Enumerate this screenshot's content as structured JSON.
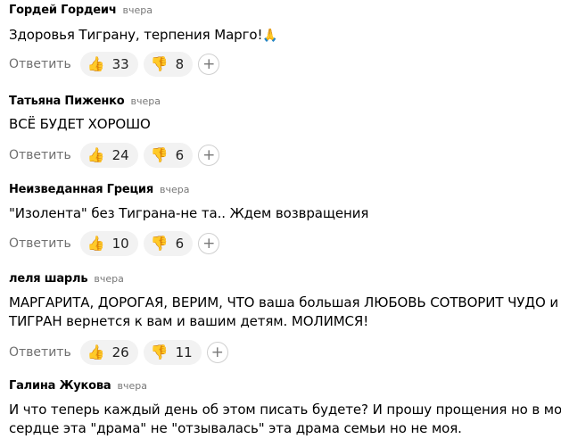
{
  "comments": [
    {
      "author": "Гордей Гордеич",
      "time": "вчера",
      "lines": [
        "Здоровья Тиграну, терпения Марго!"
      ],
      "trailing_emoji": "🙏",
      "reply_label": "Ответить",
      "likes": "33",
      "dislikes": "8"
    },
    {
      "author": "Татьяна Пиженко",
      "time": "вчера",
      "lines": [
        "ВСЁ БУДЕТ ХОРОШО"
      ],
      "reply_label": "Ответить",
      "likes": "24",
      "dislikes": "6"
    },
    {
      "author": "Неизведанная Греция",
      "time": "вчера",
      "lines": [
        "\"Изолента\" без Тиграна-не та.. Ждем возвращения"
      ],
      "reply_label": "Ответить",
      "likes": "10",
      "dislikes": "6"
    },
    {
      "author": "леля шарль",
      "time": "вчера",
      "lines": [
        "МАРГАРИТА, ДОРОГАЯ, ВЕРИМ, ЧТО ваша большая ЛЮБОВЬ СОТВОРИТ ЧУДО и т",
        "ТИГРАН вернется к вам и вашим детям. МОЛИМСЯ!"
      ],
      "reply_label": "Ответить",
      "likes": "26",
      "dislikes": "11"
    },
    {
      "author": "Галина Жукова",
      "time": "вчера",
      "lines": [
        "И что теперь каждый день об этом писать будете? И прошу прощения но в моём",
        "сердце эта \"драма\" не \"отзывалась\" эта драма семьи но не моя."
      ]
    }
  ],
  "icons": {
    "like": "thumbs-up-icon",
    "dislike": "thumbs-down-icon",
    "add_reaction": "plus-icon"
  },
  "emoji": {
    "like": "👍",
    "dislike": "👎",
    "plus": "+"
  }
}
